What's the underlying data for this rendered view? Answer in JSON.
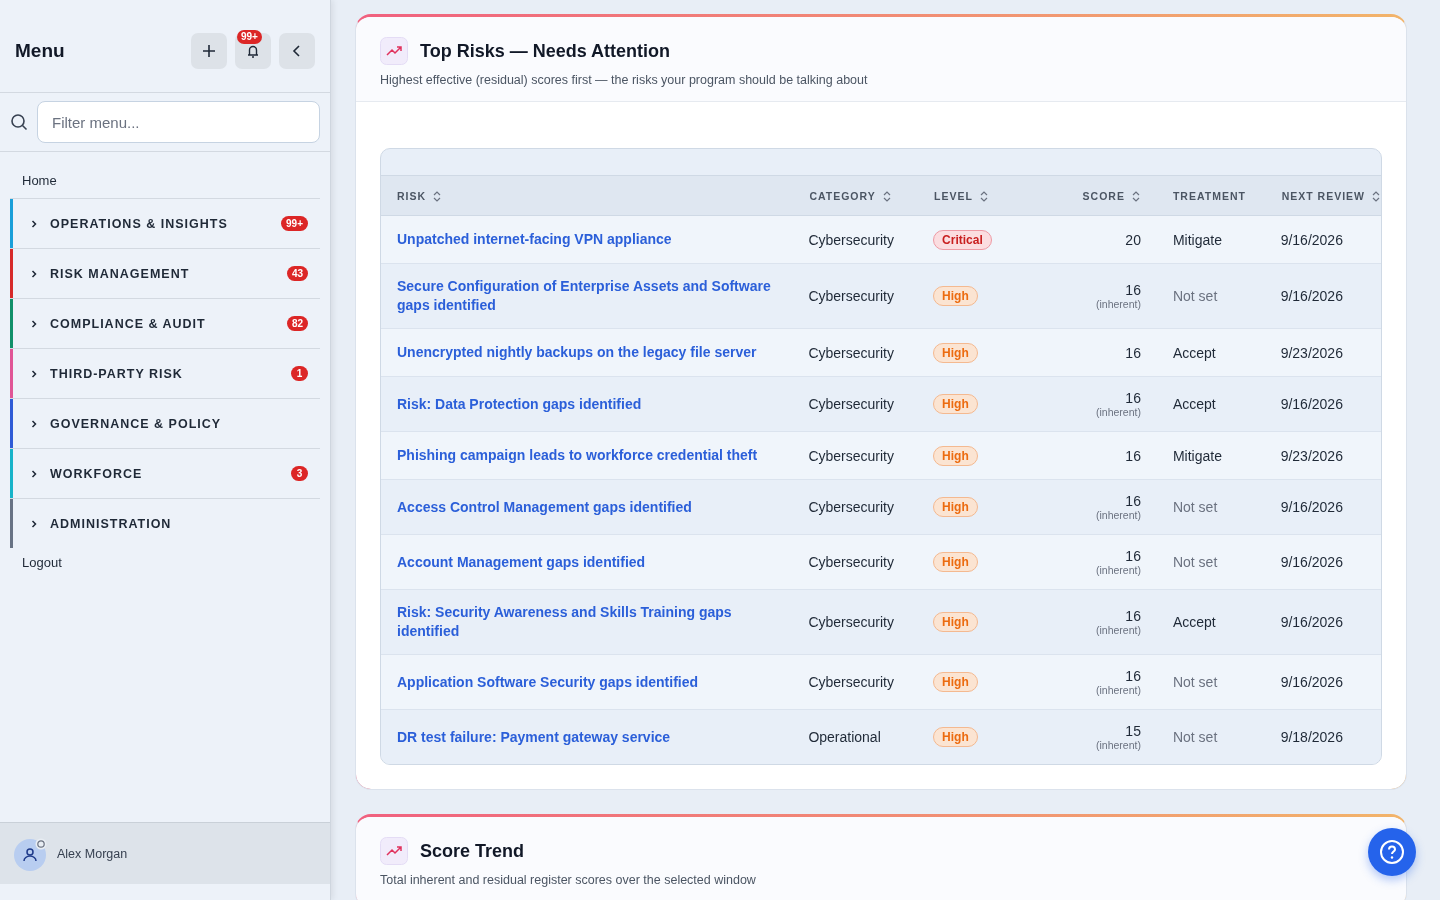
{
  "sidebar": {
    "title": "Menu",
    "notification_count": "99+",
    "filter": {
      "placeholder": "Filter menu..."
    },
    "home": "Home",
    "groups": [
      {
        "label": "OPERATIONS & INSIGHTS",
        "badge": "99+",
        "color": "#1a9fd9",
        "expanded": false
      },
      {
        "label": "RISK MANAGEMENT",
        "badge": "43",
        "color": "#d62a2a",
        "expanded": false
      },
      {
        "label": "COMPLIANCE & AUDIT",
        "badge": "82",
        "color": "#11906a",
        "expanded": false
      },
      {
        "label": "THIRD-PARTY RISK",
        "badge": "1",
        "color": "#e05596",
        "expanded": false
      },
      {
        "label": "GOVERNANCE & POLICY",
        "color": "#2f5bd6",
        "expanded": false
      },
      {
        "label": "WORKFORCE",
        "badge": "3",
        "color": "#17b3c9",
        "expanded": false
      },
      {
        "label": "ADMINISTRATION",
        "color": "#687385",
        "expanded": false
      }
    ],
    "logout": "Logout",
    "user": {
      "name": "Alex Morgan"
    }
  },
  "top_risks": {
    "title": "Top Risks — Needs Attention",
    "subtitle": "Highest effective (residual) scores first — the risks your program should be talking about",
    "table": {
      "columns": [
        {
          "label": "RISK",
          "sortable": true
        },
        {
          "label": "CATEGORY",
          "sortable": true
        },
        {
          "label": "LEVEL",
          "sortable": true
        },
        {
          "label": "SCORE",
          "sortable": true
        },
        {
          "label": "TREATMENT",
          "sortable": false
        },
        {
          "label": "NEXT REVIEW",
          "sortable": true
        }
      ],
      "rows": [
        {
          "risk": "Unpatched internet-facing VPN appliance",
          "category": "Cybersecurity",
          "level": "Critical",
          "kind": "critical",
          "score": "20",
          "treatment": "Mitigate",
          "treatment_set": true,
          "next_review": "9/16/2026"
        },
        {
          "risk": "Secure Configuration of Enterprise Assets and Software gaps identified",
          "category": "Cybersecurity",
          "level": "High",
          "kind": "high",
          "score": "16",
          "score_note": "(inherent)",
          "treatment": "Not set",
          "treatment_set": false,
          "next_review": "9/16/2026"
        },
        {
          "risk": "Unencrypted nightly backups on the legacy file server",
          "category": "Cybersecurity",
          "level": "High",
          "kind": "high",
          "score": "16",
          "treatment": "Accept",
          "treatment_set": true,
          "next_review": "9/23/2026"
        },
        {
          "risk": "Risk: Data Protection gaps identified",
          "category": "Cybersecurity",
          "level": "High",
          "kind": "high",
          "score": "16",
          "score_note": "(inherent)",
          "treatment": "Accept",
          "treatment_set": true,
          "next_review": "9/16/2026"
        },
        {
          "risk": "Phishing campaign leads to workforce credential theft",
          "category": "Cybersecurity",
          "level": "High",
          "kind": "high",
          "score": "16",
          "treatment": "Mitigate",
          "treatment_set": true,
          "next_review": "9/23/2026"
        },
        {
          "risk": "Access Control Management gaps identified",
          "category": "Cybersecurity",
          "level": "High",
          "kind": "high",
          "score": "16",
          "score_note": "(inherent)",
          "treatment": "Not set",
          "treatment_set": false,
          "next_review": "9/16/2026"
        },
        {
          "risk": "Account Management gaps identified",
          "category": "Cybersecurity",
          "level": "High",
          "kind": "high",
          "score": "16",
          "score_note": "(inherent)",
          "treatment": "Not set",
          "treatment_set": false,
          "next_review": "9/16/2026"
        },
        {
          "risk": "Risk: Security Awareness and Skills Training gaps identified",
          "category": "Cybersecurity",
          "level": "High",
          "kind": "high",
          "score": "16",
          "score_note": "(inherent)",
          "treatment": "Accept",
          "treatment_set": true,
          "next_review": "9/16/2026"
        },
        {
          "risk": "Application Software Security gaps identified",
          "category": "Cybersecurity",
          "level": "High",
          "kind": "high",
          "score": "16",
          "score_note": "(inherent)",
          "treatment": "Not set",
          "treatment_set": false,
          "next_review": "9/16/2026"
        },
        {
          "risk": "DR test failure: Payment gateway service",
          "category": "Operational",
          "level": "High",
          "kind": "high",
          "score": "15",
          "score_note": "(inherent)",
          "treatment": "Not set",
          "treatment_set": false,
          "next_review": "9/18/2026"
        }
      ]
    }
  },
  "score_trend": {
    "title": "Score Trend",
    "subtitle": "Total inherent and residual register scores over the selected window"
  }
}
